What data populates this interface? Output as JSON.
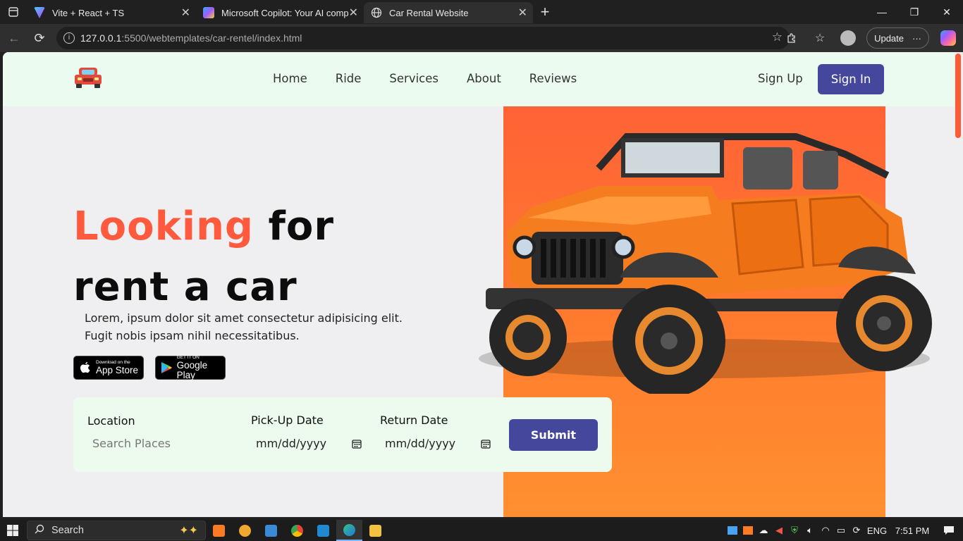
{
  "browser": {
    "tabs": [
      {
        "title": "Vite + React + TS",
        "active": false
      },
      {
        "title": "Microsoft Copilot: Your AI compa",
        "active": false
      },
      {
        "title": "Car Rental Website",
        "active": true
      }
    ],
    "url_host": "127.0.0.1",
    "url_path": ":5500/webtemplates/car-rentel/index.html",
    "update_label": "Update",
    "more_label": "···"
  },
  "site": {
    "nav": [
      "Home",
      "Ride",
      "Services",
      "About",
      "Reviews"
    ],
    "signup_label": "Sign Up",
    "signin_label": "Sign In",
    "hero": {
      "title_accent": "Looking",
      "title_rest1": " for",
      "title_line2": "rent a car",
      "desc_line1": "Lorem, ipsum dolor sit amet consectetur adipisicing elit.",
      "desc_line2": "Fugit nobis ipsam nihil necessitatibus."
    },
    "stores": {
      "appstore_small": "Download on the",
      "appstore_large": "App Store",
      "googleplay_small": "GET IT ON",
      "googleplay_large": "Google Play"
    },
    "booking": {
      "location_label": "Location",
      "location_placeholder": "Search Places",
      "pickup_label": "Pick-Up Date",
      "pickup_value": "mm/dd/yyyy",
      "return_label": "Return Date",
      "return_value": "mm/dd/yyyy",
      "submit_label": "Submit"
    },
    "colors": {
      "accent": "#ff5a3d",
      "primary": "#45479c",
      "header_bg": "#ecfbef"
    }
  },
  "taskbar": {
    "search_label": "Search",
    "lang": "ENG",
    "time": "7:51 PM"
  }
}
